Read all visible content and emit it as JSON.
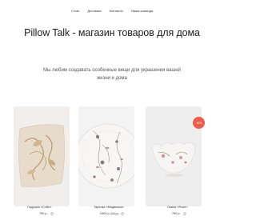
{
  "nav": {
    "items": [
      {
        "label": "О нас"
      },
      {
        "label": "Доставка"
      },
      {
        "label": "Контакты"
      },
      {
        "label": "Наша команда"
      }
    ]
  },
  "header": {
    "title": "Pillow Talk - магазин товаров для дома"
  },
  "hero": {
    "subtitle": "Мы любим создавать особенные вещи для украшения вашей жизни и дома"
  },
  "products": [
    {
      "name": "Подушка «Collin»",
      "price": "750 р."
    },
    {
      "name": "Тарелка «Медвежья»",
      "price": "2400 р.",
      "old_price": "750 р."
    },
    {
      "name": "Пиала «Rose»",
      "price": "750 р."
    }
  ],
  "badges": {
    "sale": "-30%"
  },
  "icons": {
    "cart": "shopping-bag-icon"
  },
  "colors": {
    "accent": "#f25a4a",
    "text": "#222222",
    "muted": "#999999"
  }
}
